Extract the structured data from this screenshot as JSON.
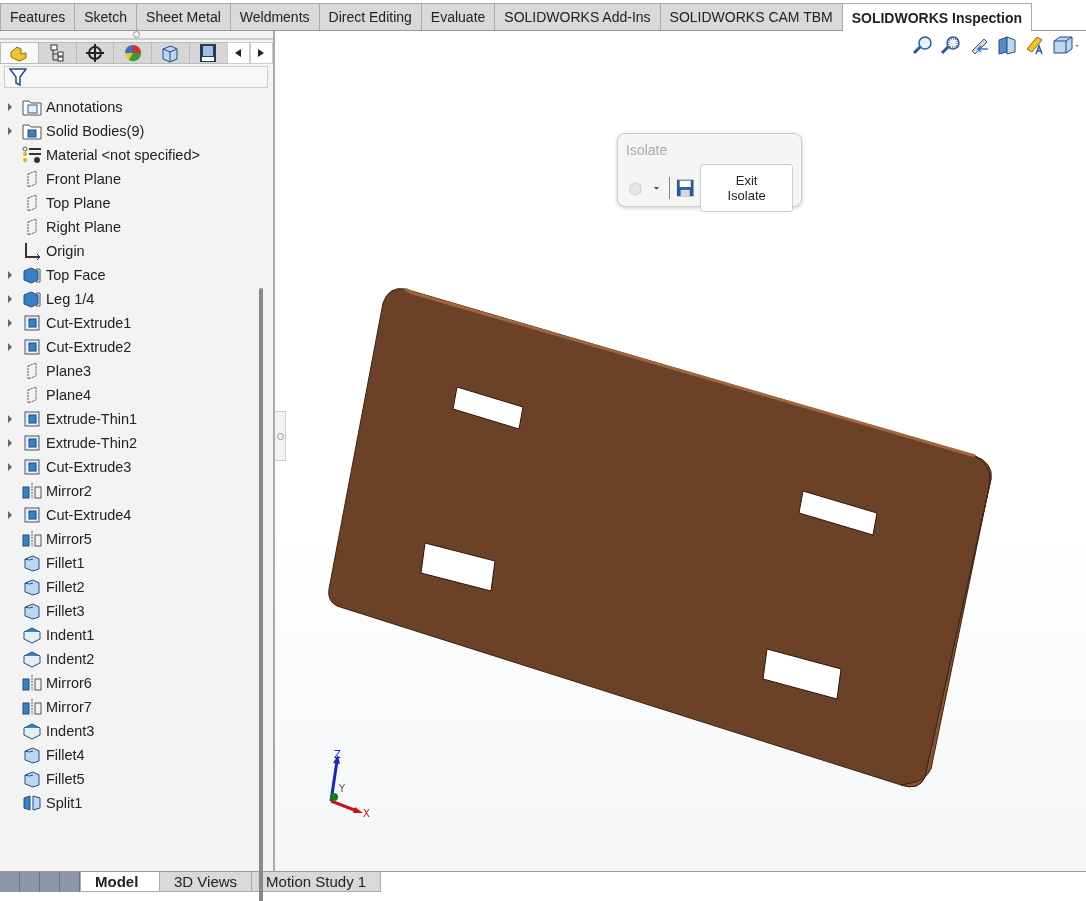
{
  "ribbon_tabs": [
    {
      "label": "Features",
      "selected": false
    },
    {
      "label": "Sketch",
      "selected": false
    },
    {
      "label": "Sheet Metal",
      "selected": false
    },
    {
      "label": "Weldments",
      "selected": false
    },
    {
      "label": "Direct Editing",
      "selected": false
    },
    {
      "label": "Evaluate",
      "selected": false
    },
    {
      "label": "SOLIDWORKS Add-Ins",
      "selected": false
    },
    {
      "label": "SOLIDWORKS CAM TBM",
      "selected": false
    },
    {
      "label": "SOLIDWORKS Inspection",
      "selected": true
    }
  ],
  "panel_tabs": [
    {
      "kind": "feature-tree",
      "selected": true
    },
    {
      "kind": "property",
      "selected": false
    },
    {
      "kind": "config",
      "selected": false
    },
    {
      "kind": "appearance",
      "selected": false
    },
    {
      "kind": "display",
      "selected": false
    },
    {
      "kind": "cam",
      "selected": false
    }
  ],
  "feature_tree": [
    {
      "label": "Annotations",
      "kind": "annotations",
      "collapsed": true
    },
    {
      "label": "Solid Bodies(9)",
      "kind": "bodies",
      "collapsed": true
    },
    {
      "label": "Material <not specified>",
      "kind": "material",
      "collapsed": false
    },
    {
      "label": "Front Plane",
      "kind": "plane",
      "collapsed": false
    },
    {
      "label": "Top Plane",
      "kind": "plane",
      "collapsed": false
    },
    {
      "label": "Right Plane",
      "kind": "plane",
      "collapsed": false
    },
    {
      "label": "Origin",
      "kind": "origin",
      "collapsed": false
    },
    {
      "label": "Top Face",
      "kind": "body",
      "collapsed": true
    },
    {
      "label": "Leg 1/4",
      "kind": "body",
      "collapsed": true
    },
    {
      "label": "Cut-Extrude1",
      "kind": "cut",
      "collapsed": true
    },
    {
      "label": "Cut-Extrude2",
      "kind": "cut",
      "collapsed": true
    },
    {
      "label": "Plane3",
      "kind": "plane",
      "collapsed": false
    },
    {
      "label": "Plane4",
      "kind": "plane",
      "collapsed": false
    },
    {
      "label": "Extrude-Thin1",
      "kind": "cut",
      "collapsed": true
    },
    {
      "label": "Extrude-Thin2",
      "kind": "cut",
      "collapsed": true
    },
    {
      "label": "Cut-Extrude3",
      "kind": "cut",
      "collapsed": true
    },
    {
      "label": "Mirror2",
      "kind": "mirror",
      "collapsed": false
    },
    {
      "label": "Cut-Extrude4",
      "kind": "cut",
      "collapsed": true
    },
    {
      "label": "Mirror5",
      "kind": "mirror",
      "collapsed": false
    },
    {
      "label": "Fillet1",
      "kind": "fillet",
      "collapsed": false
    },
    {
      "label": "Fillet2",
      "kind": "fillet",
      "collapsed": false
    },
    {
      "label": "Fillet3",
      "kind": "fillet",
      "collapsed": false
    },
    {
      "label": "Indent1",
      "kind": "indent",
      "collapsed": false
    },
    {
      "label": "Indent2",
      "kind": "indent",
      "collapsed": false
    },
    {
      "label": "Mirror6",
      "kind": "mirror",
      "collapsed": false
    },
    {
      "label": "Mirror7",
      "kind": "mirror",
      "collapsed": false
    },
    {
      "label": "Indent3",
      "kind": "indent",
      "collapsed": false
    },
    {
      "label": "Fillet4",
      "kind": "fillet",
      "collapsed": false
    },
    {
      "label": "Fillet5",
      "kind": "fillet",
      "collapsed": false
    },
    {
      "label": "Split1",
      "kind": "split",
      "collapsed": false
    }
  ],
  "isolate_popup": {
    "title": "Isolate",
    "button": "Exit Isolate"
  },
  "triad": {
    "z": "Z",
    "y": "Y",
    "x": "X"
  },
  "bottom_tabs": [
    {
      "label": "Model",
      "selected": true
    },
    {
      "label": "3D Views",
      "selected": false
    },
    {
      "label": "Motion Study 1",
      "selected": false
    }
  ]
}
